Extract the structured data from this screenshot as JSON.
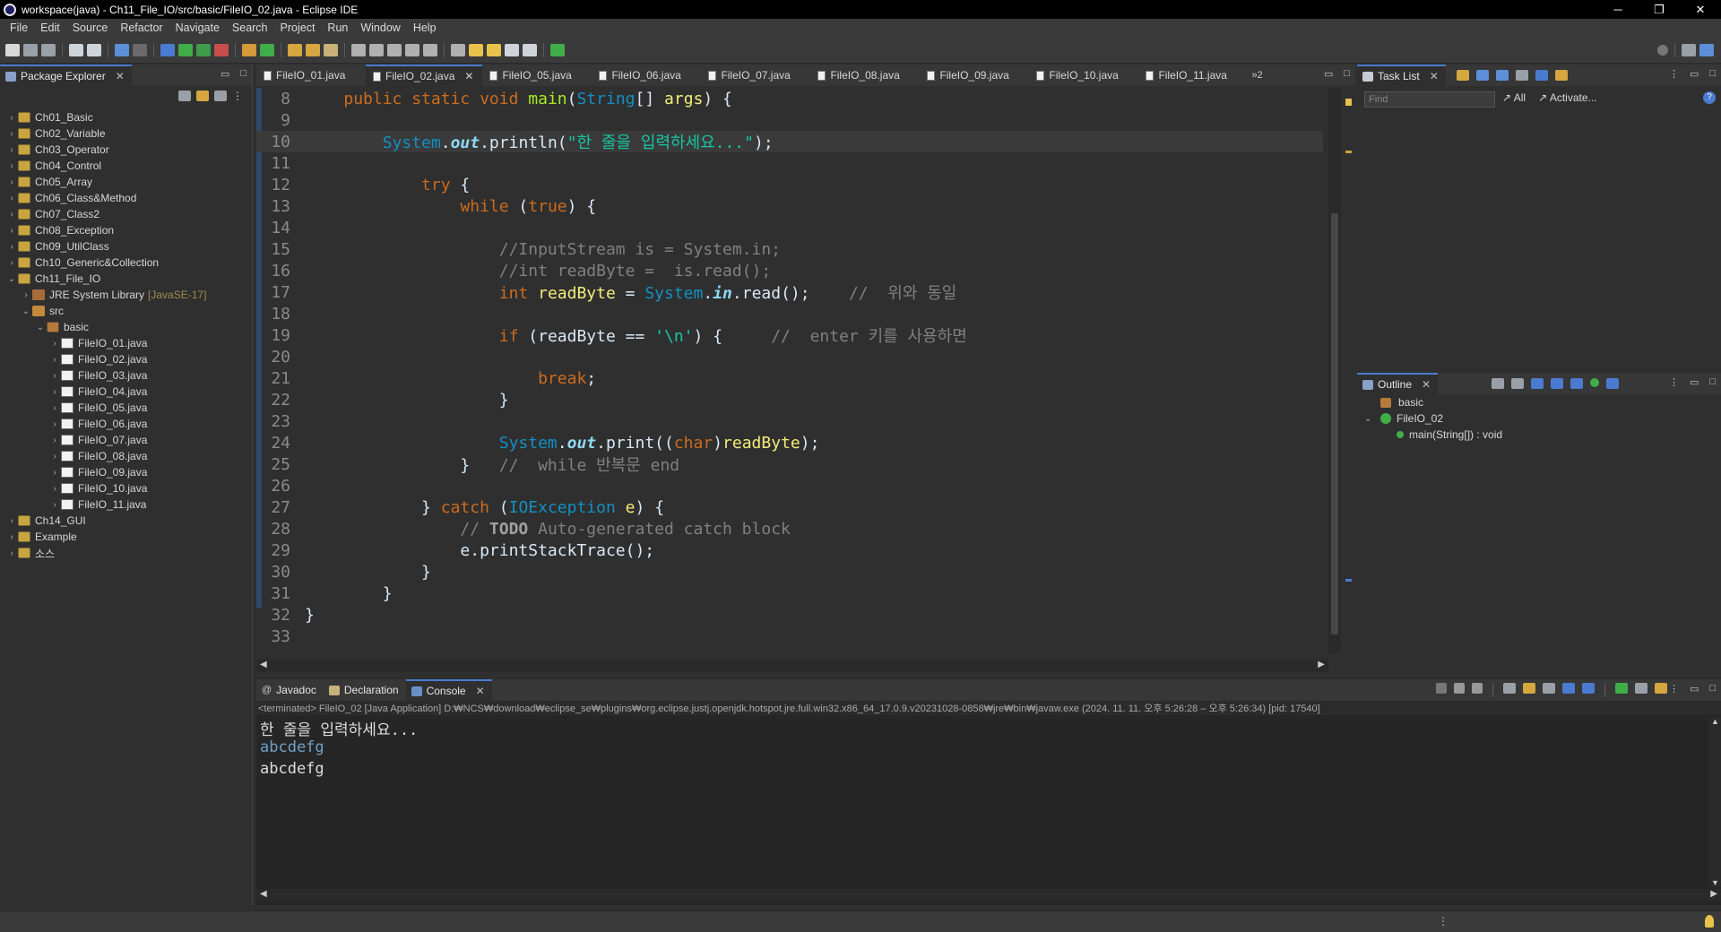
{
  "window": {
    "title": "workspace(java) - Ch11_File_IO/src/basic/FileIO_02.java - Eclipse IDE",
    "controls": [
      "─",
      "❐",
      "✕"
    ]
  },
  "menu": [
    "File",
    "Edit",
    "Source",
    "Refactor",
    "Navigate",
    "Search",
    "Project",
    "Run",
    "Window",
    "Help"
  ],
  "package_explorer": {
    "title": "Package Explorer",
    "tree": [
      {
        "label": "Ch01_Basic",
        "level": 0,
        "icon": "project-icon",
        "expanded": false
      },
      {
        "label": "Ch02_Variable",
        "level": 0,
        "icon": "project-icon",
        "expanded": false
      },
      {
        "label": "Ch03_Operator",
        "level": 0,
        "icon": "project-icon",
        "expanded": false
      },
      {
        "label": "Ch04_Control",
        "level": 0,
        "icon": "project-icon",
        "expanded": false
      },
      {
        "label": "Ch05_Array",
        "level": 0,
        "icon": "project-icon",
        "expanded": false
      },
      {
        "label": "Ch06_Class&Method",
        "level": 0,
        "icon": "project-icon",
        "expanded": false
      },
      {
        "label": "Ch07_Class2",
        "level": 0,
        "icon": "project-icon",
        "expanded": false
      },
      {
        "label": "Ch08_Exception",
        "level": 0,
        "icon": "project-icon",
        "expanded": false
      },
      {
        "label": "Ch09_UtilClass",
        "level": 0,
        "icon": "project-icon",
        "expanded": false
      },
      {
        "label": "Ch10_Generic&Collection",
        "level": 0,
        "icon": "project-icon",
        "expanded": false
      },
      {
        "label": "Ch11_File_IO",
        "level": 0,
        "icon": "project-icon",
        "expanded": true
      },
      {
        "label": "JRE System Library",
        "decoration": "[JavaSE-17]",
        "level": 1,
        "icon": "library-icon",
        "expanded": false
      },
      {
        "label": "src",
        "level": 1,
        "icon": "source-folder-icon",
        "expanded": true
      },
      {
        "label": "basic",
        "level": 2,
        "icon": "package-icon",
        "expanded": true
      },
      {
        "label": "FileIO_01.java",
        "level": 3,
        "icon": "java-file-icon",
        "expanded": false
      },
      {
        "label": "FileIO_02.java",
        "level": 3,
        "icon": "java-file-icon",
        "expanded": false
      },
      {
        "label": "FileIO_03.java",
        "level": 3,
        "icon": "java-file-icon",
        "expanded": false
      },
      {
        "label": "FileIO_04.java",
        "level": 3,
        "icon": "java-file-icon",
        "expanded": false
      },
      {
        "label": "FileIO_05.java",
        "level": 3,
        "icon": "java-file-icon",
        "expanded": false
      },
      {
        "label": "FileIO_06.java",
        "level": 3,
        "icon": "java-file-icon",
        "expanded": false
      },
      {
        "label": "FileIO_07.java",
        "level": 3,
        "icon": "java-file-icon",
        "expanded": false
      },
      {
        "label": "FileIO_08.java",
        "level": 3,
        "icon": "java-file-icon",
        "expanded": false
      },
      {
        "label": "FileIO_09.java",
        "level": 3,
        "icon": "java-file-icon",
        "expanded": false
      },
      {
        "label": "FileIO_10.java",
        "level": 3,
        "icon": "java-file-icon",
        "expanded": false
      },
      {
        "label": "FileIO_11.java",
        "level": 3,
        "icon": "java-file-icon",
        "expanded": false
      },
      {
        "label": "Ch14_GUI",
        "level": 0,
        "icon": "project-icon",
        "expanded": false
      },
      {
        "label": "Example",
        "level": 0,
        "icon": "project-icon",
        "expanded": false
      },
      {
        "label": "소스",
        "level": 0,
        "icon": "project-icon",
        "expanded": false
      }
    ]
  },
  "editor": {
    "tabs": [
      "FileIO_01.java",
      "FileIO_02.java",
      "FileIO_05.java",
      "FileIO_06.java",
      "FileIO_07.java",
      "FileIO_08.java",
      "FileIO_09.java",
      "FileIO_10.java",
      "FileIO_11.java"
    ],
    "active_tab": "FileIO_02.java",
    "overflow": "»2",
    "current_line": "10",
    "lines": [
      {
        "n": "8",
        "tokens": [
          [
            "    ",
            "tx"
          ],
          [
            "public static void ",
            "kw"
          ],
          [
            "main",
            "fn"
          ],
          [
            "(",
            "tx"
          ],
          [
            "String",
            "ty"
          ],
          [
            "[] ",
            "tx"
          ],
          [
            "args",
            "vr"
          ],
          [
            ") {",
            "tx"
          ]
        ]
      },
      {
        "n": "9",
        "tokens": []
      },
      {
        "n": "10",
        "tokens": [
          [
            "        ",
            "tx"
          ],
          [
            "System",
            "ty"
          ],
          [
            ".",
            "tx"
          ],
          [
            "out",
            "sf"
          ],
          [
            ".println(",
            "tx"
          ],
          [
            "\"한 줄을 입력하세요...\"",
            "st"
          ],
          [
            ");",
            "tx"
          ]
        ]
      },
      {
        "n": "11",
        "tokens": []
      },
      {
        "n": "12",
        "tokens": [
          [
            "            ",
            "tx"
          ],
          [
            "try",
            "kw"
          ],
          [
            " {",
            "tx"
          ]
        ]
      },
      {
        "n": "13",
        "tokens": [
          [
            "                ",
            "tx"
          ],
          [
            "while",
            "kw"
          ],
          [
            " (",
            "tx"
          ],
          [
            "true",
            "kw"
          ],
          [
            ") {",
            "tx"
          ]
        ]
      },
      {
        "n": "14",
        "tokens": []
      },
      {
        "n": "15",
        "tokens": [
          [
            "                    ",
            "tx"
          ],
          [
            "//InputStream is = System.in;",
            "cm"
          ]
        ]
      },
      {
        "n": "16",
        "tokens": [
          [
            "                    ",
            "tx"
          ],
          [
            "//int readByte =  is.read();",
            "cm"
          ]
        ]
      },
      {
        "n": "17",
        "tokens": [
          [
            "                    ",
            "tx"
          ],
          [
            "int",
            "kw"
          ],
          [
            " ",
            "tx"
          ],
          [
            "readByte",
            "vr"
          ],
          [
            " = ",
            "tx"
          ],
          [
            "System",
            "ty"
          ],
          [
            ".",
            "tx"
          ],
          [
            "in",
            "sf"
          ],
          [
            ".read();    ",
            "tx"
          ],
          [
            "//  위와 동일",
            "cm"
          ]
        ]
      },
      {
        "n": "18",
        "tokens": []
      },
      {
        "n": "19",
        "tokens": [
          [
            "                    ",
            "tx"
          ],
          [
            "if",
            "kw"
          ],
          [
            " (readByte == ",
            "tx"
          ],
          [
            "'\\n'",
            "st"
          ],
          [
            ") {     ",
            "tx"
          ],
          [
            "//  enter 키를 사용하면",
            "cm"
          ]
        ]
      },
      {
        "n": "20",
        "tokens": []
      },
      {
        "n": "21",
        "tokens": [
          [
            "                        ",
            "tx"
          ],
          [
            "break",
            "kw"
          ],
          [
            ";",
            "tx"
          ]
        ]
      },
      {
        "n": "22",
        "tokens": [
          [
            "                    ",
            "tx"
          ],
          [
            "}",
            "tx"
          ]
        ]
      },
      {
        "n": "23",
        "tokens": []
      },
      {
        "n": "24",
        "tokens": [
          [
            "                    ",
            "tx"
          ],
          [
            "System",
            "ty"
          ],
          [
            ".",
            "tx"
          ],
          [
            "out",
            "sf"
          ],
          [
            ".print((",
            "tx"
          ],
          [
            "char",
            "kw"
          ],
          [
            ")",
            "tx"
          ],
          [
            "readByte",
            "vr"
          ],
          [
            ");",
            "tx"
          ]
        ]
      },
      {
        "n": "25",
        "tokens": [
          [
            "                ",
            "tx"
          ],
          [
            "}   ",
            "tx"
          ],
          [
            "//  while 반복문 end",
            "cm"
          ]
        ]
      },
      {
        "n": "26",
        "tokens": []
      },
      {
        "n": "27",
        "tokens": [
          [
            "            ",
            "tx"
          ],
          [
            "} ",
            "tx"
          ],
          [
            "catch",
            "kw"
          ],
          [
            " (",
            "tx"
          ],
          [
            "IOException",
            "ty"
          ],
          [
            " ",
            "tx"
          ],
          [
            "e",
            "vr"
          ],
          [
            ") {",
            "tx"
          ]
        ]
      },
      {
        "n": "28",
        "tokens": [
          [
            "                ",
            "tx"
          ],
          [
            "// ",
            "cm"
          ],
          [
            "TODO",
            "todo"
          ],
          [
            " Auto-generated catch block",
            "cm"
          ]
        ]
      },
      {
        "n": "29",
        "tokens": [
          [
            "                ",
            "tx"
          ],
          [
            "e.printStackTrace();",
            "tx"
          ]
        ]
      },
      {
        "n": "30",
        "tokens": [
          [
            "            ",
            "tx"
          ],
          [
            "}",
            "tx"
          ]
        ]
      },
      {
        "n": "31",
        "tokens": [
          [
            "        ",
            "tx"
          ],
          [
            "}",
            "tx"
          ]
        ]
      },
      {
        "n": "32",
        "tokens": [
          [
            "",
            "tx"
          ],
          [
            "}",
            "tx"
          ]
        ]
      },
      {
        "n": "33",
        "tokens": []
      }
    ]
  },
  "task_list": {
    "title": "Task List",
    "find_placeholder": "Find",
    "all_label": "All",
    "activate_label": "Activate..."
  },
  "outline": {
    "title": "Outline",
    "items": [
      {
        "label": "basic",
        "icon": "package-icon"
      },
      {
        "label": "FileIO_02",
        "icon": "class-icon"
      },
      {
        "label": "main(String[]) : void",
        "icon": "method-icon"
      }
    ]
  },
  "bottom_views": {
    "tabs": [
      "Javadoc",
      "Declaration",
      "Console"
    ],
    "active": "Console"
  },
  "console": {
    "meta": "<terminated> FileIO_02 [Java Application] D:₩NCS₩download₩eclipse_se₩plugins₩org.eclipse.justj.openjdk.hotspot.jre.full.win32.x86_64_17.0.9.v20231028-0858₩jre₩bin₩javaw.exe  (2024. 11. 11. 오후 5:26:28 – 오후 5:26:34) [pid: 17540]",
    "lines": [
      {
        "text": "한 줄을 입력하세요...",
        "kind": "out"
      },
      {
        "text": "abcdefg",
        "kind": "in"
      },
      {
        "text": "abcdefg",
        "kind": "out"
      }
    ]
  },
  "colors": {
    "keyword": "#cc6c1d",
    "type": "#1290c3",
    "string": "#17c6a3",
    "comment": "#808080",
    "method": "#a7ec21",
    "active_tab_accent": "#4a7bd0"
  }
}
